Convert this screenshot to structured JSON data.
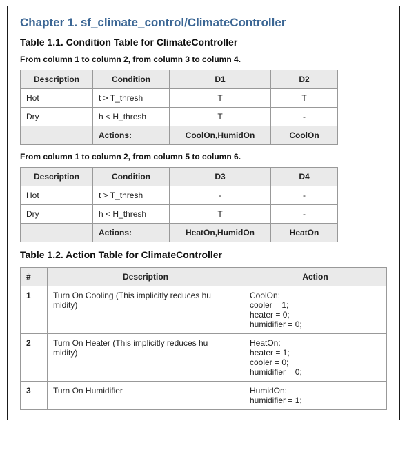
{
  "chapter_title": "Chapter 1. sf_climate_control/ClimateController",
  "table1_title": "Table 1.1. Condition Table for ClimateController",
  "cond_a": {
    "caption": "From column 1 to column 2, from column 3 to column 4.",
    "headers": {
      "desc": "Description",
      "cond": "Condition",
      "d1": "D1",
      "d2": "D2"
    },
    "rows": [
      {
        "desc": "Hot",
        "cond": "t > T_thresh",
        "d1": "T",
        "d2": "T"
      },
      {
        "desc": "Dry",
        "cond": "h < H_thresh",
        "d1": "T",
        "d2": "-"
      }
    ],
    "actions_label": "Actions:",
    "actions": {
      "d1": "CoolOn,HumidOn",
      "d2": "CoolOn"
    }
  },
  "cond_b": {
    "caption": "From column 1 to column 2, from column 5 to column 6.",
    "headers": {
      "desc": "Description",
      "cond": "Condition",
      "d1": "D3",
      "d2": "D4"
    },
    "rows": [
      {
        "desc": "Hot",
        "cond": "t > T_thresh",
        "d1": "-",
        "d2": "-"
      },
      {
        "desc": "Dry",
        "cond": "h < H_thresh",
        "d1": "T",
        "d2": "-"
      }
    ],
    "actions_label": "Actions:",
    "actions": {
      "d1": "HeatOn,HumidOn",
      "d2": "HeatOn"
    }
  },
  "table2_title": "Table 1.2. Action Table for ClimateController",
  "action_table": {
    "headers": {
      "num": "#",
      "desc": "Description",
      "action": "Action"
    },
    "rows": [
      {
        "num": "1",
        "desc": "Turn On Cooling (This implicitly reduces hu\nmidity)",
        "action": "CoolOn:\ncooler = 1;\nheater = 0;\nhumidifier = 0;"
      },
      {
        "num": "2",
        "desc": "Turn On Heater (This implicitly reduces hu\nmidity)",
        "action": "HeatOn:\nheater = 1;\ncooler = 0;\nhumidifier = 0;"
      },
      {
        "num": "3",
        "desc": "Turn On Humidifier",
        "action": "HumidOn:\nhumidifier = 1;"
      }
    ]
  }
}
